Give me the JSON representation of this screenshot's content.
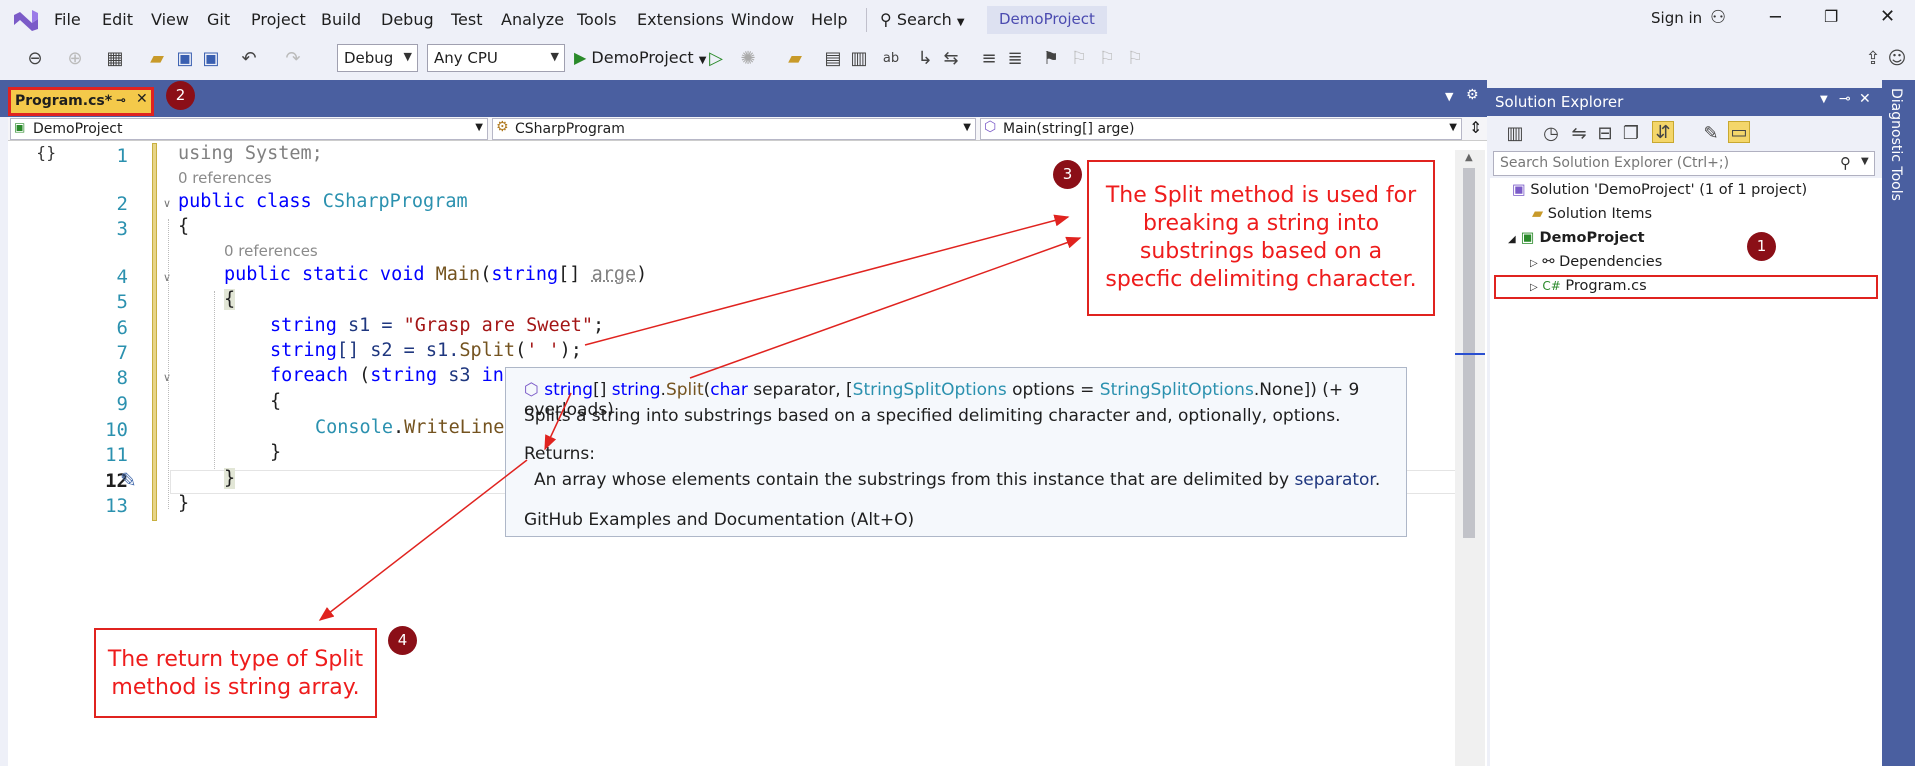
{
  "menu": [
    "File",
    "Edit",
    "View",
    "Git",
    "Project",
    "Build",
    "Debug",
    "Test",
    "Analyze",
    "Tools",
    "Extensions",
    "Window",
    "Help"
  ],
  "search_label": "Search",
  "project_badge": "DemoProject",
  "sign_in": "Sign in",
  "toolbar": {
    "config": "Debug",
    "platform": "Any CPU",
    "run_target": "DemoProject"
  },
  "doc_tab": {
    "label": "Program.cs*"
  },
  "nav": {
    "project": "DemoProject",
    "class": "CSharpProgram",
    "member": "Main(string[] arge)"
  },
  "code": {
    "line_numbers": [
      "1",
      "2",
      "3",
      "4",
      "5",
      "6",
      "7",
      "8",
      "9",
      "10",
      "11",
      "12",
      "13"
    ],
    "ref0": "0 references",
    "ref1": "0 references",
    "l1": "using System;",
    "l2a": "public class ",
    "l2b": "CSharpProgram",
    "l3": "{",
    "l4a": "public static void ",
    "l4b": "Main",
    "l4c": "(",
    "l4d": "string",
    "l4e": "[] ",
    "l4f": "arge",
    "l4g": ")",
    "l5": "{",
    "l6a": "string",
    "l6b": " s1 = ",
    "l6c": "\"Grasp are Sweet\"",
    "l6d": ";",
    "l7a": "string",
    "l7b": "[] s2 = s1.",
    "l7c": "Split",
    "l7d": "(",
    "l7e": "' '",
    "l7f": ");",
    "l8a": "foreach",
    "l8b": " (",
    "l8c": "string",
    "l8d": " s3 ",
    "l8e": "in",
    "l9": "{",
    "l10a": "Console",
    "l10b": ".",
    "l10c": "WriteLine",
    "l11": "}",
    "l12": "}",
    "l13": "}"
  },
  "tooltip": {
    "sig_string": "string",
    "sig_arr": "[] ",
    "sig_type": "string",
    "sig_dot": ".",
    "sig_method": "Split",
    "sig_open": "(",
    "sig_char": "char",
    "sig_sep": " separator, [",
    "sig_opts_type": "StringSplitOptions",
    "sig_opts": " options = ",
    "sig_opts_type2": "StringSplitOptions",
    "sig_none": ".None]) (+ 9 overloads)",
    "summary": "Splits a string into substrings based on a specified delimiting character and, optionally, options.",
    "returns_label": "Returns:",
    "returns_text": "An array whose elements contain the substrings from this instance that are delimited by ",
    "returns_param": "separator",
    "returns_end": ".",
    "link": "GitHub Examples and Documentation (Alt+O)"
  },
  "solution_explorer": {
    "title": "Solution Explorer",
    "search_placeholder": "Search Solution Explorer (Ctrl+;)",
    "solution": "Solution 'DemoProject' (1 of 1 project)",
    "solution_items": "Solution Items",
    "project": "DemoProject",
    "dependencies": "Dependencies",
    "program": "Program.cs"
  },
  "side_tab": "Diagnostic Tools",
  "callouts": {
    "c3": "The Split method is used for breaking a string into substrings based on a specfic delimiting character.",
    "c4": "The return type of Split method is string array."
  },
  "badges": [
    "1",
    "2",
    "3",
    "4"
  ],
  "colors": {
    "accent": "#4a5fa0",
    "annotation": "#e0231f",
    "badge": "#8b0f17",
    "tab_active": "#f4c94a"
  }
}
